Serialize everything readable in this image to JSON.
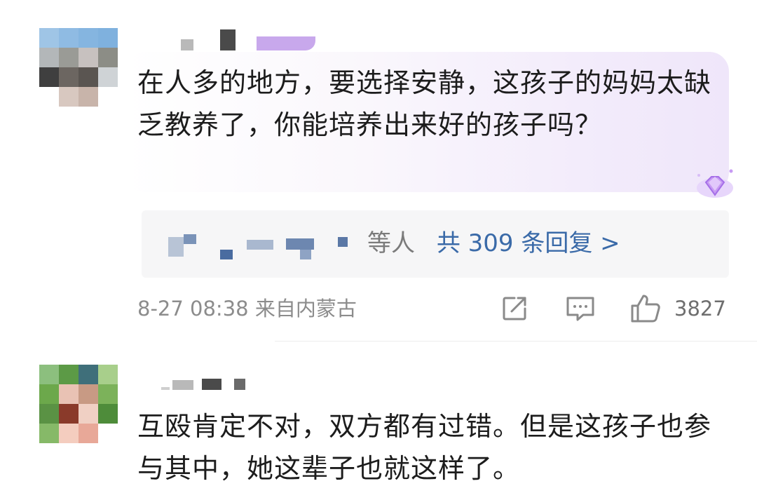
{
  "comments": [
    {
      "text": "在人多的地方，要选择安静，这孩子的妈妈太缺乏教养了，你能培养出来好的孩子吗？",
      "reply_summary": {
        "who": "等人",
        "count": "共 309 条回复 >"
      },
      "meta": "8-27 08:38 来自内蒙古",
      "like_count": "3827"
    },
    {
      "text": "互殴肯定不对，双方都有过错。但是这孩子也参与其中，她这辈子也就这样了。"
    }
  ],
  "icons": {
    "share": "share-icon",
    "comment": "comment-icon",
    "like": "thumbs-up-icon",
    "badge": "diamond-badge-icon"
  },
  "colors": {
    "reply_link": "#3a6aa8",
    "meta_text": "#8c8c8c",
    "bubble_tint": "#efe6fa"
  }
}
